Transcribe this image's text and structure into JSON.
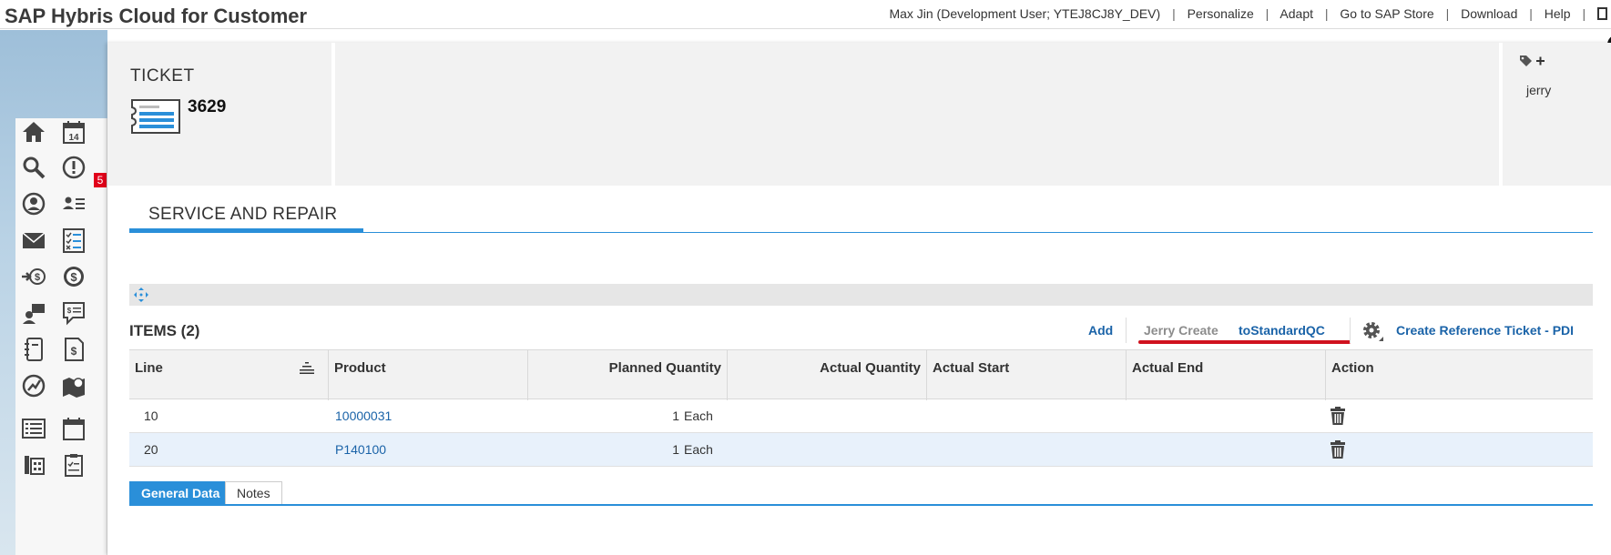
{
  "header": {
    "app_title": "SAP Hybris Cloud for Customer",
    "user": "Max Jin (Development User; YTEJ8CJ8Y_DEV)",
    "links": [
      "Personalize",
      "Adapt",
      "Go to SAP Store",
      "Download",
      "Help"
    ],
    "separator": "|"
  },
  "sidebar": {
    "badge_count": "5",
    "icons": [
      "home-icon",
      "calendar-14-icon",
      "search-icon",
      "alert-icon",
      "contact-icon",
      "contact-list-icon",
      "mail-icon",
      "checklist-icon",
      "money-in-icon",
      "currency-icon",
      "team-icon",
      "quote-icon",
      "notebook-icon",
      "invoice-icon",
      "growth-icon",
      "map-pin-icon",
      "list-icon",
      "calendar-icon",
      "phone-icon",
      "clipboard-icon"
    ]
  },
  "ticket": {
    "label": "TICKET",
    "number": "3629",
    "tag_user": "jerry"
  },
  "section": {
    "tab_label": "SERVICE AND REPAIR"
  },
  "items": {
    "title": "ITEMS (2)",
    "toolbar": {
      "add": "Add",
      "jerry_create": "Jerry Create",
      "to_standard_qc": "toStandardQC",
      "create_reference": "Create Reference Ticket - PDI"
    },
    "columns": [
      "Line",
      "Product",
      "Planned Quantity",
      "Actual Quantity",
      "Actual Start",
      "Actual End",
      "Action"
    ],
    "rows": [
      {
        "line": "10",
        "product": "10000031",
        "planned_qty": "1",
        "unit": "Each"
      },
      {
        "line": "20",
        "product": "P140100",
        "planned_qty": "1",
        "unit": "Each"
      }
    ]
  },
  "bottom_tabs": {
    "general": "General Data",
    "notes": "Notes"
  },
  "colors": {
    "accent": "#2a8fd9",
    "link": "#1a63a8",
    "highlight": "#d0121e"
  }
}
